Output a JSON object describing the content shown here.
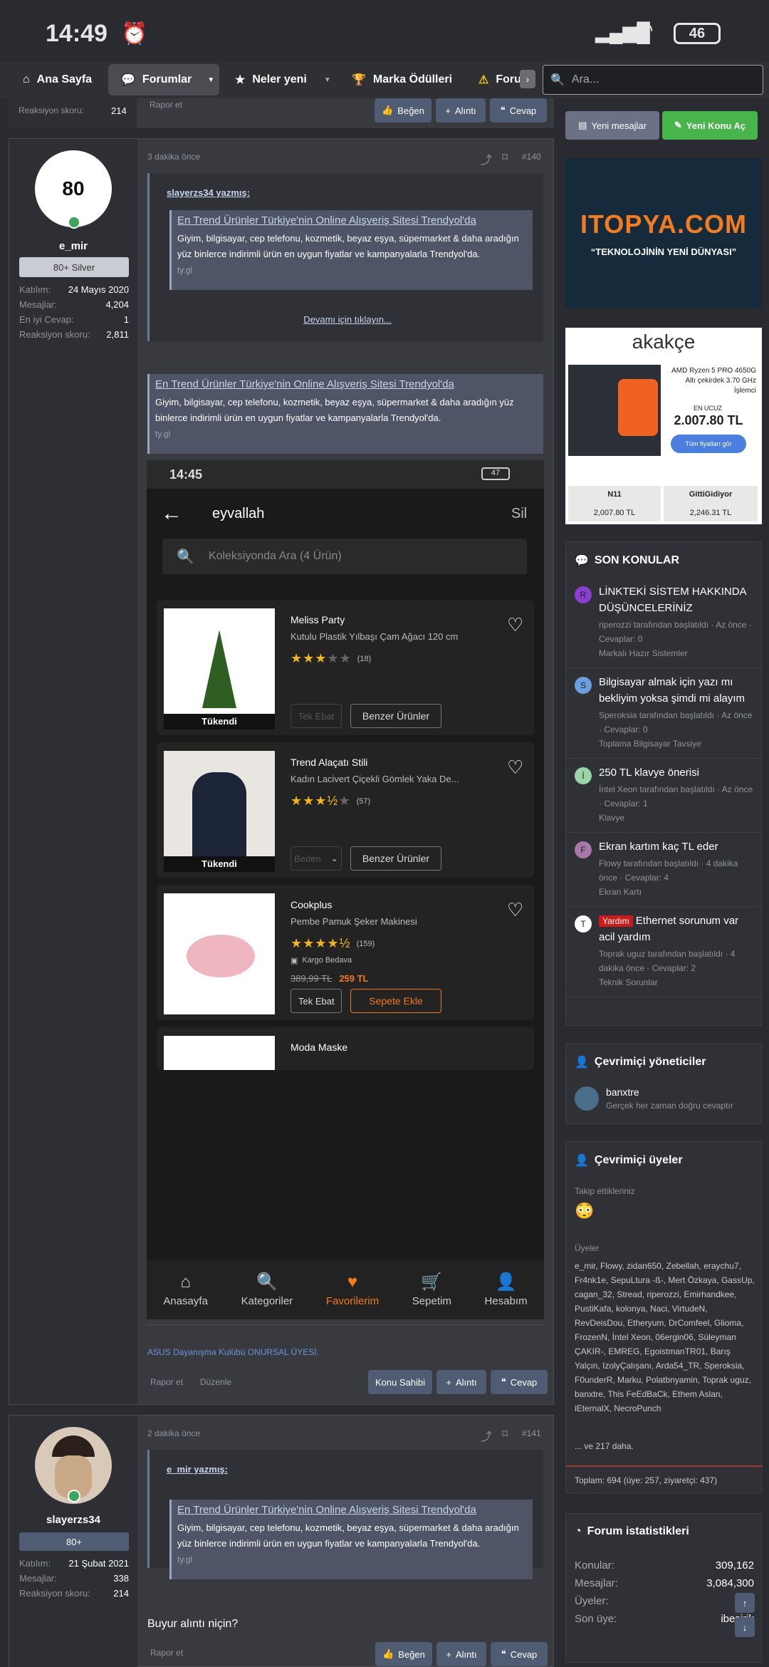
{
  "status": {
    "time": "14:49",
    "battery": "46"
  },
  "nav": {
    "home": "Ana Sayfa",
    "forums": "Forumlar",
    "whats_new": "Neler yeni",
    "awards": "Marka Ödülleri",
    "more": "Foru",
    "search_placeholder": "Ara..."
  },
  "top_strip": {
    "left": "Reaksiyon skoru:",
    "val": "214",
    "report": "Rapor et",
    "like": "Beğen",
    "quote": "Alıntı",
    "reply": "Cevap"
  },
  "side_buttons": {
    "new_msgs": "Yeni mesajlar",
    "new_topic": "Yeni Konu Aç"
  },
  "post1": {
    "username": "e_mir",
    "badge": "80+ Silver",
    "stats": [
      [
        "Katılım:",
        "24 Mayıs 2020"
      ],
      [
        "Mesajlar:",
        "4,204"
      ],
      [
        "En iyi Cevap:",
        "1"
      ],
      [
        "Reaksiyon skoru:",
        "2,811"
      ]
    ],
    "time": "3 dakika önce",
    "num": "#140",
    "quote_author": "slayerzs34 yazmış:",
    "unfurl_title": "En Trend Ürünler Türkiye'nin Online Alışveriş Sitesi Trendyol'da",
    "unfurl_desc": "Giyim, bilgisayar, cep telefonu, kozmetik, beyaz eşya, süpermarket & daha aradığın yüz binlerce indirimli ürün en uygun fiyatlar ve kampanyalarla Trendyol'da.",
    "unfurl_url": "ty.gl",
    "expand": "Devamı için tıklayın...",
    "signature": "ASUS Dayanışma Kulübü ONURSAL ÜYESİ.",
    "report": "Rapor et",
    "edit": "Düzenle",
    "owner": "Konu Sahibi",
    "quote_btn": "Alıntı",
    "reply": "Cevap"
  },
  "phone": {
    "time": "14:45",
    "battery": "47",
    "title": "eyvallah",
    "delete": "Sil",
    "search_placeholder": "Koleksiyonda Ara (4 Ürün)",
    "products": [
      {
        "brand": "Meliss Party",
        "name": "Kutulu Plastik Yılbaşı Çam Ağacı 120 cm",
        "rating": "(18)",
        "tag": "Tükendi",
        "opt": "Tek Ebat",
        "action": "Benzer Ürünler"
      },
      {
        "brand": "Trend Alaçatı Stili",
        "name": "Kadın Lacivert Çiçekli Gömlek Yaka De...",
        "rating": "(57)",
        "tag": "Tükendi",
        "opt": "Beden",
        "action": "Benzer Ürünler"
      },
      {
        "brand": "Cookplus",
        "name": "Pembe Pamuk Şeker Makinesi",
        "rating": "(159)",
        "shipping": "Kargo Bedava",
        "old_price": "389,99 TL",
        "price": "259 TL",
        "opt": "Tek Ebat",
        "action": "Sepete Ekle"
      },
      {
        "brand": "Moda Maske"
      }
    ],
    "tabs": [
      "Anasayfa",
      "Kategoriler",
      "Favorilerim",
      "Sepetim",
      "Hesabım"
    ]
  },
  "post2": {
    "username": "slayerzs34",
    "badge": "80+",
    "stats": [
      [
        "Katılım:",
        "21 Şubat 2021"
      ],
      [
        "Mesajlar:",
        "338"
      ],
      [
        "Reaksiyon skoru:",
        "214"
      ]
    ],
    "time": "2 dakika önce",
    "num": "#141",
    "quote_author": "e_mir yazmış:",
    "body": "Buyur alıntı niçin?",
    "report": "Rapor et",
    "like": "Beğen",
    "quote_btn": "Alıntı",
    "reply": "Cevap"
  },
  "ad1": {
    "logo": "ITOPYA.COM",
    "slogan": "“TEKNOLOJİNİN YENİ DÜNYASI”"
  },
  "ad2": {
    "brand": "akakçe",
    "product": "AMD Ryzen 5 PRO 4650G Altı çekirdek 3.70 GHz İşlemci",
    "cheapest": "EN UCUZ",
    "price": "2.007.80 TL",
    "cta": "Tüm fiyatları gör",
    "s1": "N11",
    "p1": "2,007.80 TL",
    "s2": "GittiGidiyor",
    "p2": "2,246.31 TL"
  },
  "recent": {
    "title": "SON KONULAR",
    "items": [
      {
        "av": "R",
        "t": "LİNKTEKİ SİSTEM HAKKINDA DÜŞÜNCELERİNİZ",
        "m": "riperozzi tarafından başlatıldı · Az önce · Cevaplar: 0",
        "f": "Markalı Hazır Sistemler"
      },
      {
        "av": "S",
        "t": "Bilgisayar almak için yazı mı bekliyim yoksa şimdi mi alayım",
        "m": "Speroksia tarafından başlatıldı · Az önce · Cevaplar: 0",
        "f": "Toplama Bilgisayar Tavsiye"
      },
      {
        "av": "İ",
        "t": "250 TL klavye önerisi",
        "m": "İntel Xeon tarafından başlatıldı · Az önce · Cevaplar: 1",
        "f": "Klavye"
      },
      {
        "av": "F",
        "t": "Ekran kartım kaç TL eder",
        "m": "Flowy tarafından başlatıldı · 4 dakika önce · Cevaplar: 4",
        "f": "Ekran Kartı"
      },
      {
        "av": "T",
        "label": "Yardım",
        "t": "Ethernet sorunum var acil yardım",
        "m": "Toprak uguz tarafından başlatıldı · 4 dakika önce · Cevaplar: 2",
        "f": "Teknik Sorunlar"
      }
    ]
  },
  "admins": {
    "title": "Çevrimiçi yöneticiler",
    "name": "banxtre",
    "sub": "Gerçek her zaman doğru cevaptır"
  },
  "members": {
    "title": "Çevrimiçi üyeler",
    "following": "Takip ettikleriniz",
    "members_label": "Üyeler",
    "list": "e_mir, Flowy, zidan650, Zebellah, eraychu7, Fr4nk1e, SepuLtura -ß-, Mert Özkaya, GassUp, cagan_32, Stread, riperozzi, Emirhandkee, PustiKafa, kolonya, Naci, VirtudeN, RevDeisDou, Etheryum, DrComfeel, Glioma, FrozenN, İntel Xeon, 06ergin06, Süleyman ÇAKIR-, EMREG, EgoistmanTR01, Barış Yalçın, IzolyÇalışanı, Arda54_TR, Speroksia, F0underR, Marku, Polatbnyamin, Toprak uguz, banxtre, This FeEdBaCk, Ethem Aslan, iEternalX, NecroPunch",
    "more": "... ve 217 daha.",
    "total": "Toplam: 694 (üye: 257, ziyaretçi: 437)"
  },
  "stats": {
    "title": "Forum istatistikleri",
    "rows": [
      [
        "Konular:",
        "309,162"
      ],
      [
        "Mesajlar:",
        "3,084,300"
      ],
      [
        "Üyeler:",
        "53,"
      ],
      [
        "Son üye:",
        "ibesirik"
      ]
    ]
  }
}
